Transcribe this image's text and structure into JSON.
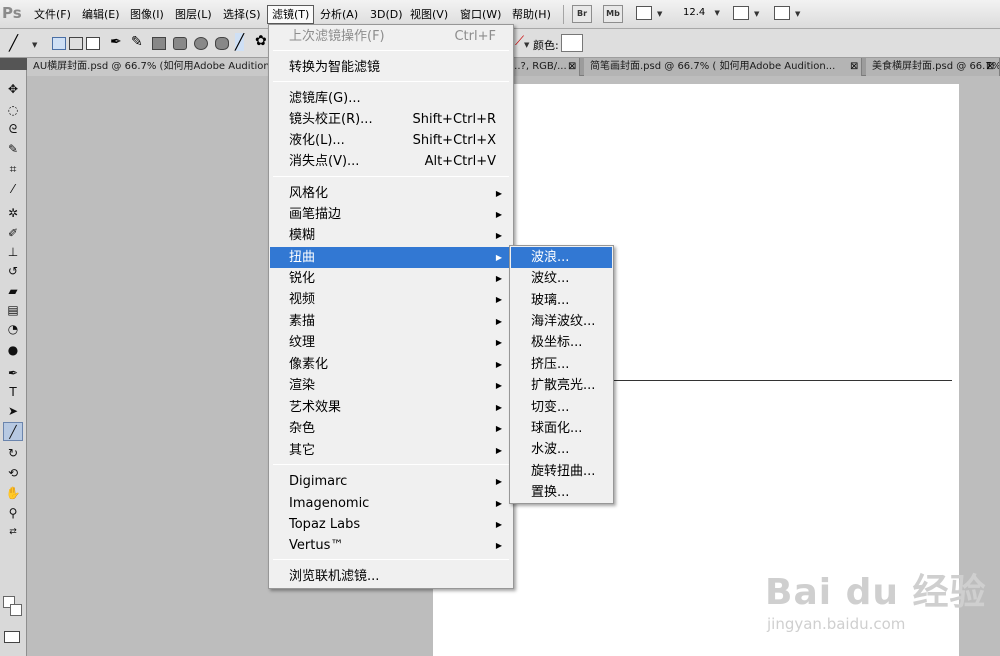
{
  "app": {
    "logo": "Ps"
  },
  "menubar": {
    "items": [
      "文件(F)",
      "编辑(E)",
      "图像(I)",
      "图层(L)",
      "选择(S)",
      "滤镜(T)",
      "分析(A)",
      "3D(D)",
      "视图(V)",
      "窗口(W)",
      "帮助(H)"
    ],
    "bridge_label": "Br",
    "minibridge_label": "Mb",
    "zoom": "12.4"
  },
  "options": {
    "color_label": "颜色:"
  },
  "tabs": [
    "AU横屏封面.psd @ 66.7% (如何用Adobe Audition...",
    "...?, RGB/...",
    "简笔画封面.psd @ 66.7% ( 如何用Adobe Audition...",
    "美食横屏封面.psd @ 66.7% (如..."
  ],
  "filter_menu": {
    "last_filter": {
      "label": "上次滤镜操作(F)",
      "shortcut": "Ctrl+F"
    },
    "smart_filter": "转换为智能滤镜",
    "group1": [
      {
        "label": "滤镜库(G)...",
        "shortcut": ""
      },
      {
        "label": "镜头校正(R)...",
        "shortcut": "Shift+Ctrl+R"
      },
      {
        "label": "液化(L)...",
        "shortcut": "Shift+Ctrl+X"
      },
      {
        "label": "消失点(V)...",
        "shortcut": "Alt+Ctrl+V"
      }
    ],
    "group2": [
      "风格化",
      "画笔描边",
      "模糊",
      "扭曲",
      "锐化",
      "视频",
      "素描",
      "纹理",
      "像素化",
      "渲染",
      "艺术效果",
      "杂色",
      "其它"
    ],
    "group3": [
      "Digimarc",
      "Imagenomic",
      "Topaz Labs",
      "Vertus™"
    ],
    "browse": "浏览联机滤镜..."
  },
  "distort_submenu": [
    "波浪...",
    "波纹...",
    "玻璃...",
    "海洋波纹...",
    "极坐标...",
    "挤压...",
    "扩散亮光...",
    "切变...",
    "球面化...",
    "水波...",
    "旋转扭曲...",
    "置换..."
  ],
  "watermark": {
    "logo": "Bai du 经验",
    "url": "jingyan.baidu.com"
  },
  "colors": {
    "highlight": "#3278d3",
    "menu_bg": "#f0f0f0",
    "workspace": "#bdbdbd"
  }
}
